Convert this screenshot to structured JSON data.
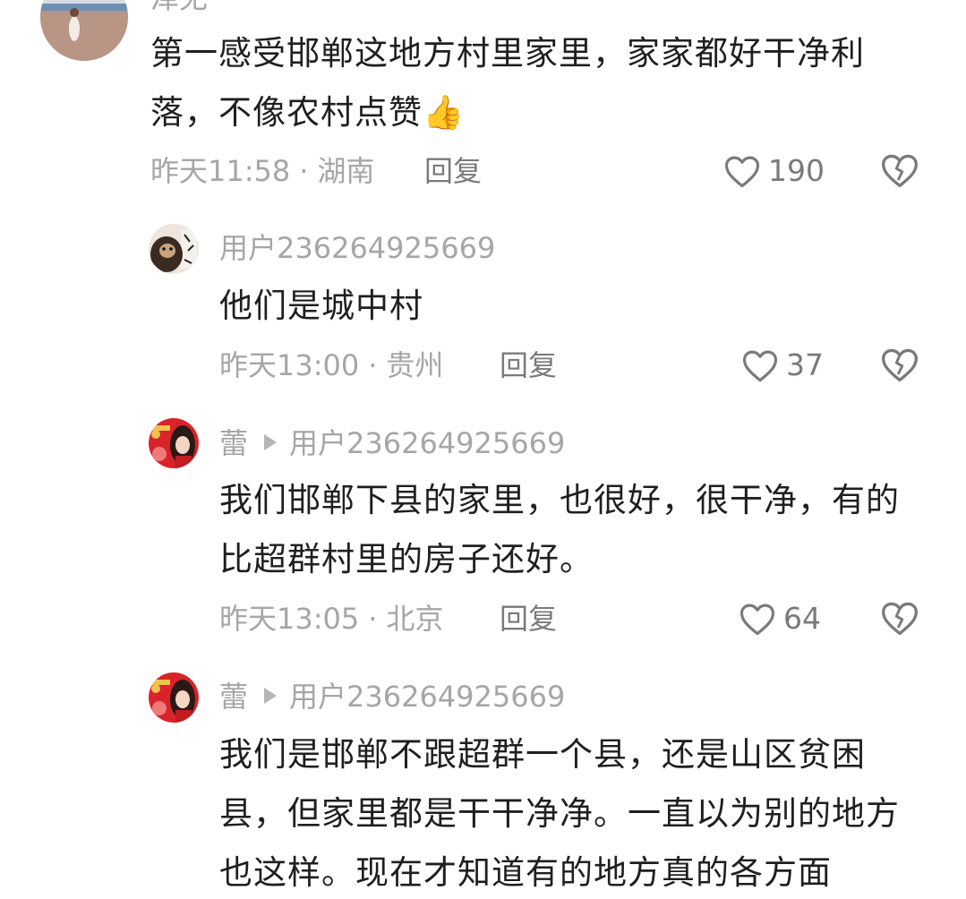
{
  "comments": [
    {
      "username": "泽无",
      "text": "第一感受邯郸这地方村里家里，家家都好干净利落，不像农村点赞👍",
      "time": "昨天11:58",
      "location": "湖南",
      "reply_label": "回复",
      "likes": "190",
      "avatar_icon": "photo-beach-avatar"
    },
    {
      "username": "用户236264925669",
      "text": "他们是城中村",
      "time": "昨天13:00",
      "location": "贵州",
      "reply_label": "回复",
      "likes": "37",
      "avatar_icon": "monkey-avatar"
    },
    {
      "username": "蕾",
      "reply_to": "用户236264925669",
      "text": "我们邯郸下县的家里，也很好，很干净，有的比超群村里的房子还好。",
      "time": "昨天13:05",
      "location": "北京",
      "reply_label": "回复",
      "likes": "64",
      "avatar_icon": "new-year-avatar"
    },
    {
      "username": "蕾",
      "reply_to": "用户236264925669",
      "text": "我们是邯郸不跟超群一个县，还是山区贫困县，但家里都是干干净净。一直以为别的地方也这样。现在才知道有的地方真的各方面",
      "avatar_icon": "new-year-avatar"
    }
  ],
  "icons": {
    "like": "heart-outline-icon",
    "dislike": "broken-heart-icon",
    "reply_arrow": "play-triangle-icon"
  },
  "colors": {
    "text": "#1f1f1f",
    "meta": "#a6a6a6",
    "action": "#7a7a7a"
  }
}
